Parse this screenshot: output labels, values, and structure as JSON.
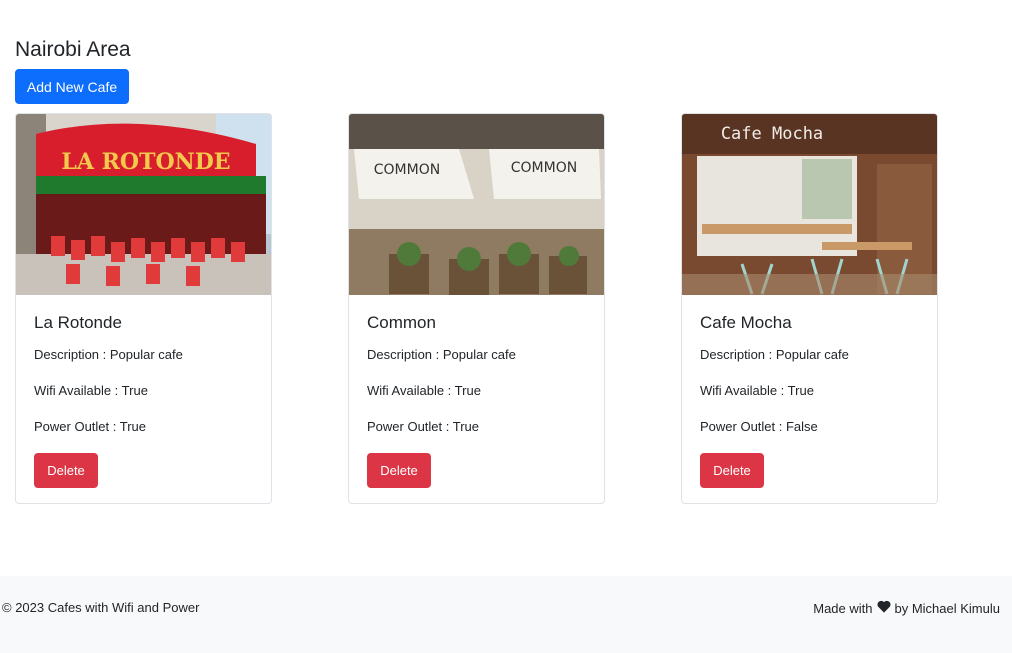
{
  "page": {
    "title": "Nairobi Area",
    "add_button": "Add New Cafe"
  },
  "cafes": [
    {
      "name": "La Rotonde",
      "image_icon": "cafe-photo",
      "description": "Description : Popular cafe",
      "wifi": "Wifi Available : True",
      "power": "Power Outlet : True",
      "delete_label": "Delete",
      "image_text": "LA ROTONDE"
    },
    {
      "name": "Common",
      "image_icon": "cafe-photo",
      "description": "Description : Popular cafe",
      "wifi": "Wifi Available : True",
      "power": "Power Outlet : True",
      "delete_label": "Delete",
      "image_text": "COMMON"
    },
    {
      "name": "Cafe Mocha",
      "image_icon": "cafe-photo",
      "description": "Description : Popular cafe",
      "wifi": "Wifi Available : True",
      "power": "Power Outlet : False",
      "delete_label": "Delete",
      "image_text": "Cafe Mocha"
    }
  ],
  "footer": {
    "copyright": "© 2023 Cafes with Wifi and Power",
    "made_with": "Made with",
    "heart_icon": "heart-icon",
    "by": "by Michael Kimulu"
  },
  "colors": {
    "primary": "#0d6efd",
    "danger": "#dc3545",
    "footer_bg": "#f8f9fa"
  }
}
